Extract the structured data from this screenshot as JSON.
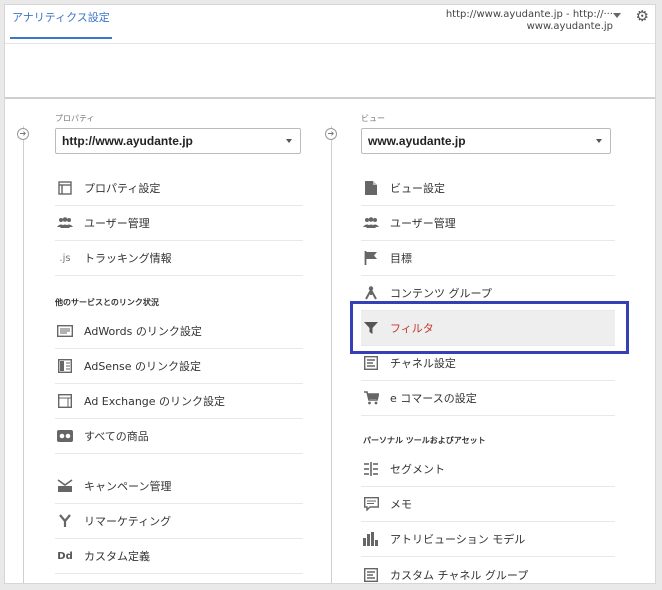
{
  "header": {
    "tab_label": "アナリティクス設定",
    "account_line1": "http://www.ayudante.jp - http://···",
    "account_line2": "www.ayudante.jp",
    "settings_icon": "gear-icon"
  },
  "property": {
    "label": "プロパティ",
    "selected": "http://www.ayudante.jp",
    "items": [
      {
        "label": "プロパティ設定",
        "icon": "window-icon"
      },
      {
        "label": "ユーザー管理",
        "icon": "users-icon"
      },
      {
        "label": "トラッキング情報",
        "icon": "js-icon"
      }
    ],
    "links_section": "他のサービスとのリンク状況",
    "link_items": [
      {
        "label": "AdWords のリンク設定",
        "icon": "adwords-icon"
      },
      {
        "label": "AdSense のリンク設定",
        "icon": "adsense-icon"
      },
      {
        "label": "Ad Exchange のリンク設定",
        "icon": "adexchange-icon"
      },
      {
        "label": "すべての商品",
        "icon": "products-icon"
      }
    ],
    "other_items": [
      {
        "label": "キャンペーン管理",
        "icon": "campaign-icon"
      },
      {
        "label": "リマーケティング",
        "icon": "remarketing-icon"
      },
      {
        "label": "カスタム定義",
        "icon": "dd-icon"
      }
    ]
  },
  "view": {
    "label": "ビュー",
    "selected": "www.ayudante.jp",
    "items": [
      {
        "label": "ビュー設定",
        "icon": "document-icon"
      },
      {
        "label": "ユーザー管理",
        "icon": "users-icon"
      },
      {
        "label": "目標",
        "icon": "flag-icon"
      },
      {
        "label": "コンテンツ グループ",
        "icon": "content-group-icon"
      },
      {
        "label": "フィルタ",
        "icon": "filter-icon",
        "active": true
      },
      {
        "label": "チャネル設定",
        "icon": "channel-icon"
      },
      {
        "label": "e コマースの設定",
        "icon": "cart-icon"
      }
    ],
    "personal_section": "パーソナル ツールおよびアセット",
    "personal_items": [
      {
        "label": "セグメント",
        "icon": "segment-icon"
      },
      {
        "label": "メモ",
        "icon": "memo-icon"
      },
      {
        "label": "アトリビューション モデル",
        "icon": "attribution-icon"
      },
      {
        "label": "カスタム チャネル グループ",
        "icon": "custom-channel-icon"
      }
    ]
  },
  "colors": {
    "accent": "#3b76c8",
    "active_text": "#c0392b",
    "highlight_border": "#3540b5"
  }
}
